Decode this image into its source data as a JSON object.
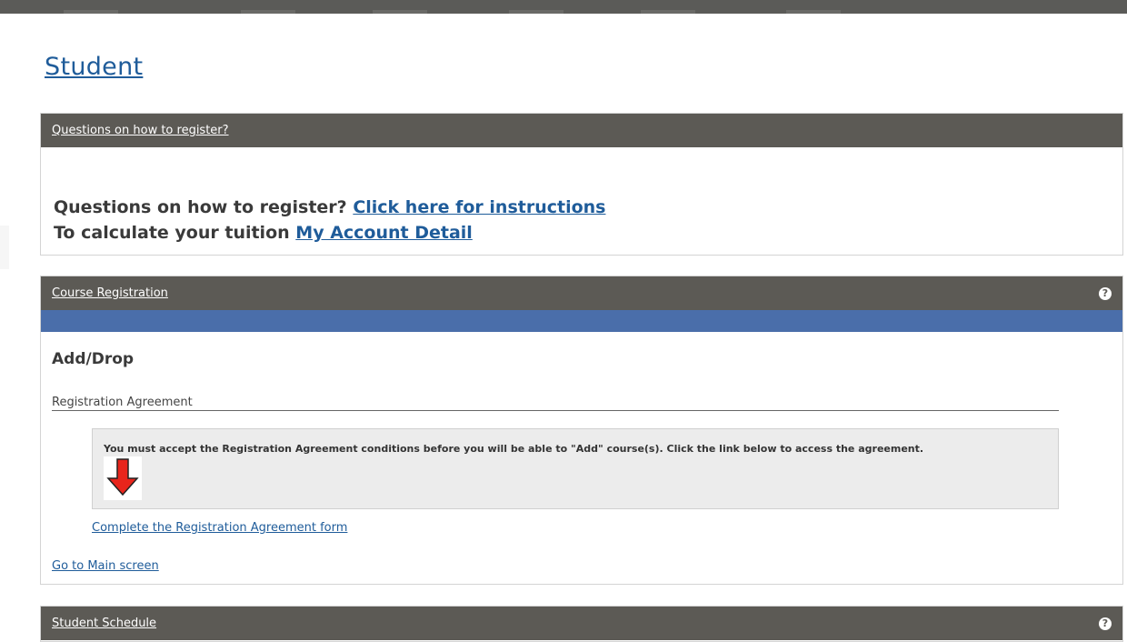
{
  "page": {
    "title": "Student"
  },
  "panels": {
    "questions": {
      "header": "Questions on how to register?",
      "line1_text": "Questions on how to register?",
      "line1_link": "Click here for instructions",
      "line2_text": "To calculate your tuition",
      "line2_link": "My Account Detail"
    },
    "course_registration": {
      "header": "Course Registration",
      "help_icon": "?",
      "heading": "Add/Drop",
      "section_label": "Registration Agreement",
      "notice": "You must accept the Registration Agreement conditions before you will be able to \"Add\" course(s). Click the link below to access the agreement.",
      "agreement_link": "Complete the Registration Agreement form",
      "main_link": "Go to Main screen"
    },
    "student_schedule": {
      "header": "Student Schedule",
      "help_icon": "?"
    }
  },
  "colors": {
    "header_bg": "#5c5a55",
    "accent_bar": "#4a6eaa",
    "link": "#1f5c9a",
    "arrow": "#e8251c"
  },
  "icons": {
    "help": "question-circle-icon",
    "arrow": "red-down-arrow-icon"
  }
}
